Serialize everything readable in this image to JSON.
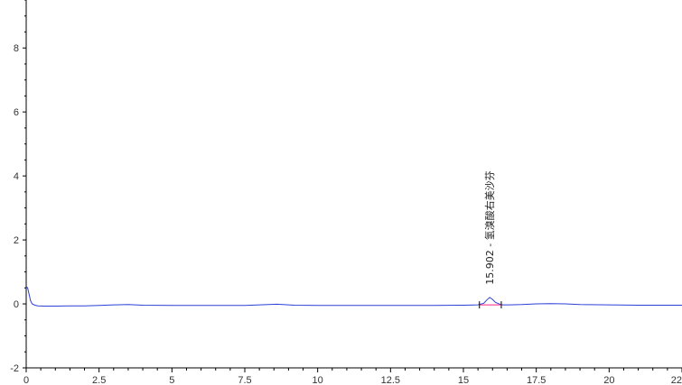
{
  "chart_data": {
    "type": "line",
    "title": "",
    "xlabel": "",
    "ylabel": "",
    "xlim": [
      0,
      22.5
    ],
    "ylim": [
      -2,
      9.5
    ],
    "x_ticks": [
      0,
      2.5,
      5,
      7.5,
      10,
      12.5,
      15,
      17.5,
      20,
      22.5
    ],
    "x_tick_labels": [
      "0",
      "2.5",
      "5",
      "7.5",
      "10",
      "12.5",
      "15",
      "17.5",
      "20",
      "22"
    ],
    "y_ticks": [
      -2,
      0,
      2,
      4,
      6,
      8
    ],
    "y_tick_labels": [
      "-2",
      "0",
      "2",
      "4",
      "6",
      "8"
    ],
    "grid": false,
    "series": [
      {
        "color": "#2b3fd6",
        "x": [
          0,
          0.05,
          0.1,
          0.15,
          0.2,
          0.3,
          0.4,
          0.6,
          1.0,
          1.5,
          2.0,
          2.5,
          3.0,
          3.5,
          4.0,
          5.0,
          6.0,
          7.0,
          7.5,
          8.0,
          8.6,
          9.2,
          10.0,
          11.0,
          12.0,
          13.0,
          14.0,
          15.0,
          15.5,
          15.7,
          15.8,
          15.902,
          16.0,
          16.1,
          16.3,
          16.6,
          17.0,
          17.5,
          18.0,
          18.5,
          19.0,
          20.0,
          21.0,
          22.0,
          22.5
        ],
        "y": [
          0.55,
          0.5,
          0.3,
          0.1,
          0.0,
          -0.04,
          -0.06,
          -0.07,
          -0.07,
          -0.06,
          -0.06,
          -0.05,
          -0.03,
          -0.02,
          -0.04,
          -0.05,
          -0.05,
          -0.05,
          -0.05,
          -0.03,
          -0.01,
          -0.04,
          -0.05,
          -0.05,
          -0.05,
          -0.05,
          -0.05,
          -0.04,
          -0.03,
          0.02,
          0.12,
          0.2,
          0.14,
          0.05,
          -0.03,
          -0.03,
          -0.02,
          0.0,
          0.01,
          0.0,
          -0.02,
          -0.03,
          -0.04,
          -0.04,
          -0.04
        ]
      }
    ],
    "peaks": [
      {
        "x": 15.902,
        "label": "15.902 - 氢溴酸右美沙芬",
        "baseline_start": 15.55,
        "baseline_end": 16.3
      }
    ],
    "peak_marker_color": "#ff2080",
    "axis_color": "#000000"
  }
}
